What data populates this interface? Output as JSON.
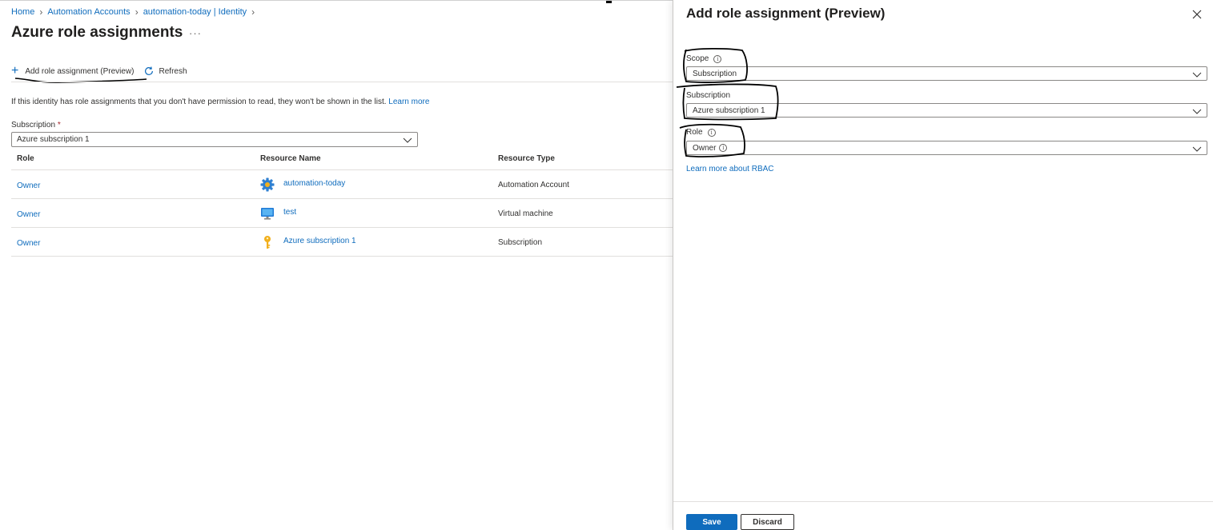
{
  "breadcrumb": [
    {
      "label": "Home"
    },
    {
      "label": "Automation Accounts"
    },
    {
      "label": "automation-today | Identity"
    }
  ],
  "page": {
    "title": "Azure role assignments",
    "more_label": "···"
  },
  "toolbar": {
    "add_label": "Add role assignment (Preview)",
    "refresh_label": "Refresh"
  },
  "info": {
    "text": "If this identity has role assignments that you don't have permission to read, they won't be shown in the list.",
    "link": "Learn more"
  },
  "subscription_filter": {
    "label": "Subscription",
    "required_mark": "*",
    "value": "Azure subscription 1"
  },
  "table": {
    "columns": [
      "Role",
      "Resource Name",
      "Resource Type"
    ],
    "rows": [
      {
        "role": "Owner",
        "icon": "gear-icon",
        "name": "automation-today",
        "type": "Automation Account"
      },
      {
        "role": "Owner",
        "icon": "monitor-icon",
        "name": "test",
        "type": "Virtual machine"
      },
      {
        "role": "Owner",
        "icon": "key-icon",
        "name": "Azure subscription 1",
        "type": "Subscription"
      }
    ]
  },
  "panel": {
    "title": "Add role assignment (Preview)",
    "scope": {
      "label": "Scope",
      "value": "Subscription"
    },
    "subscription": {
      "label": "Subscription",
      "value": "Azure subscription 1"
    },
    "role": {
      "label": "Role",
      "value": "Owner"
    },
    "rbac_link": "Learn more about RBAC",
    "save_label": "Save",
    "discard_label": "Discard"
  },
  "colors": {
    "accent": "#0f6cbd",
    "text": "#323130",
    "required": "#a4262c"
  }
}
